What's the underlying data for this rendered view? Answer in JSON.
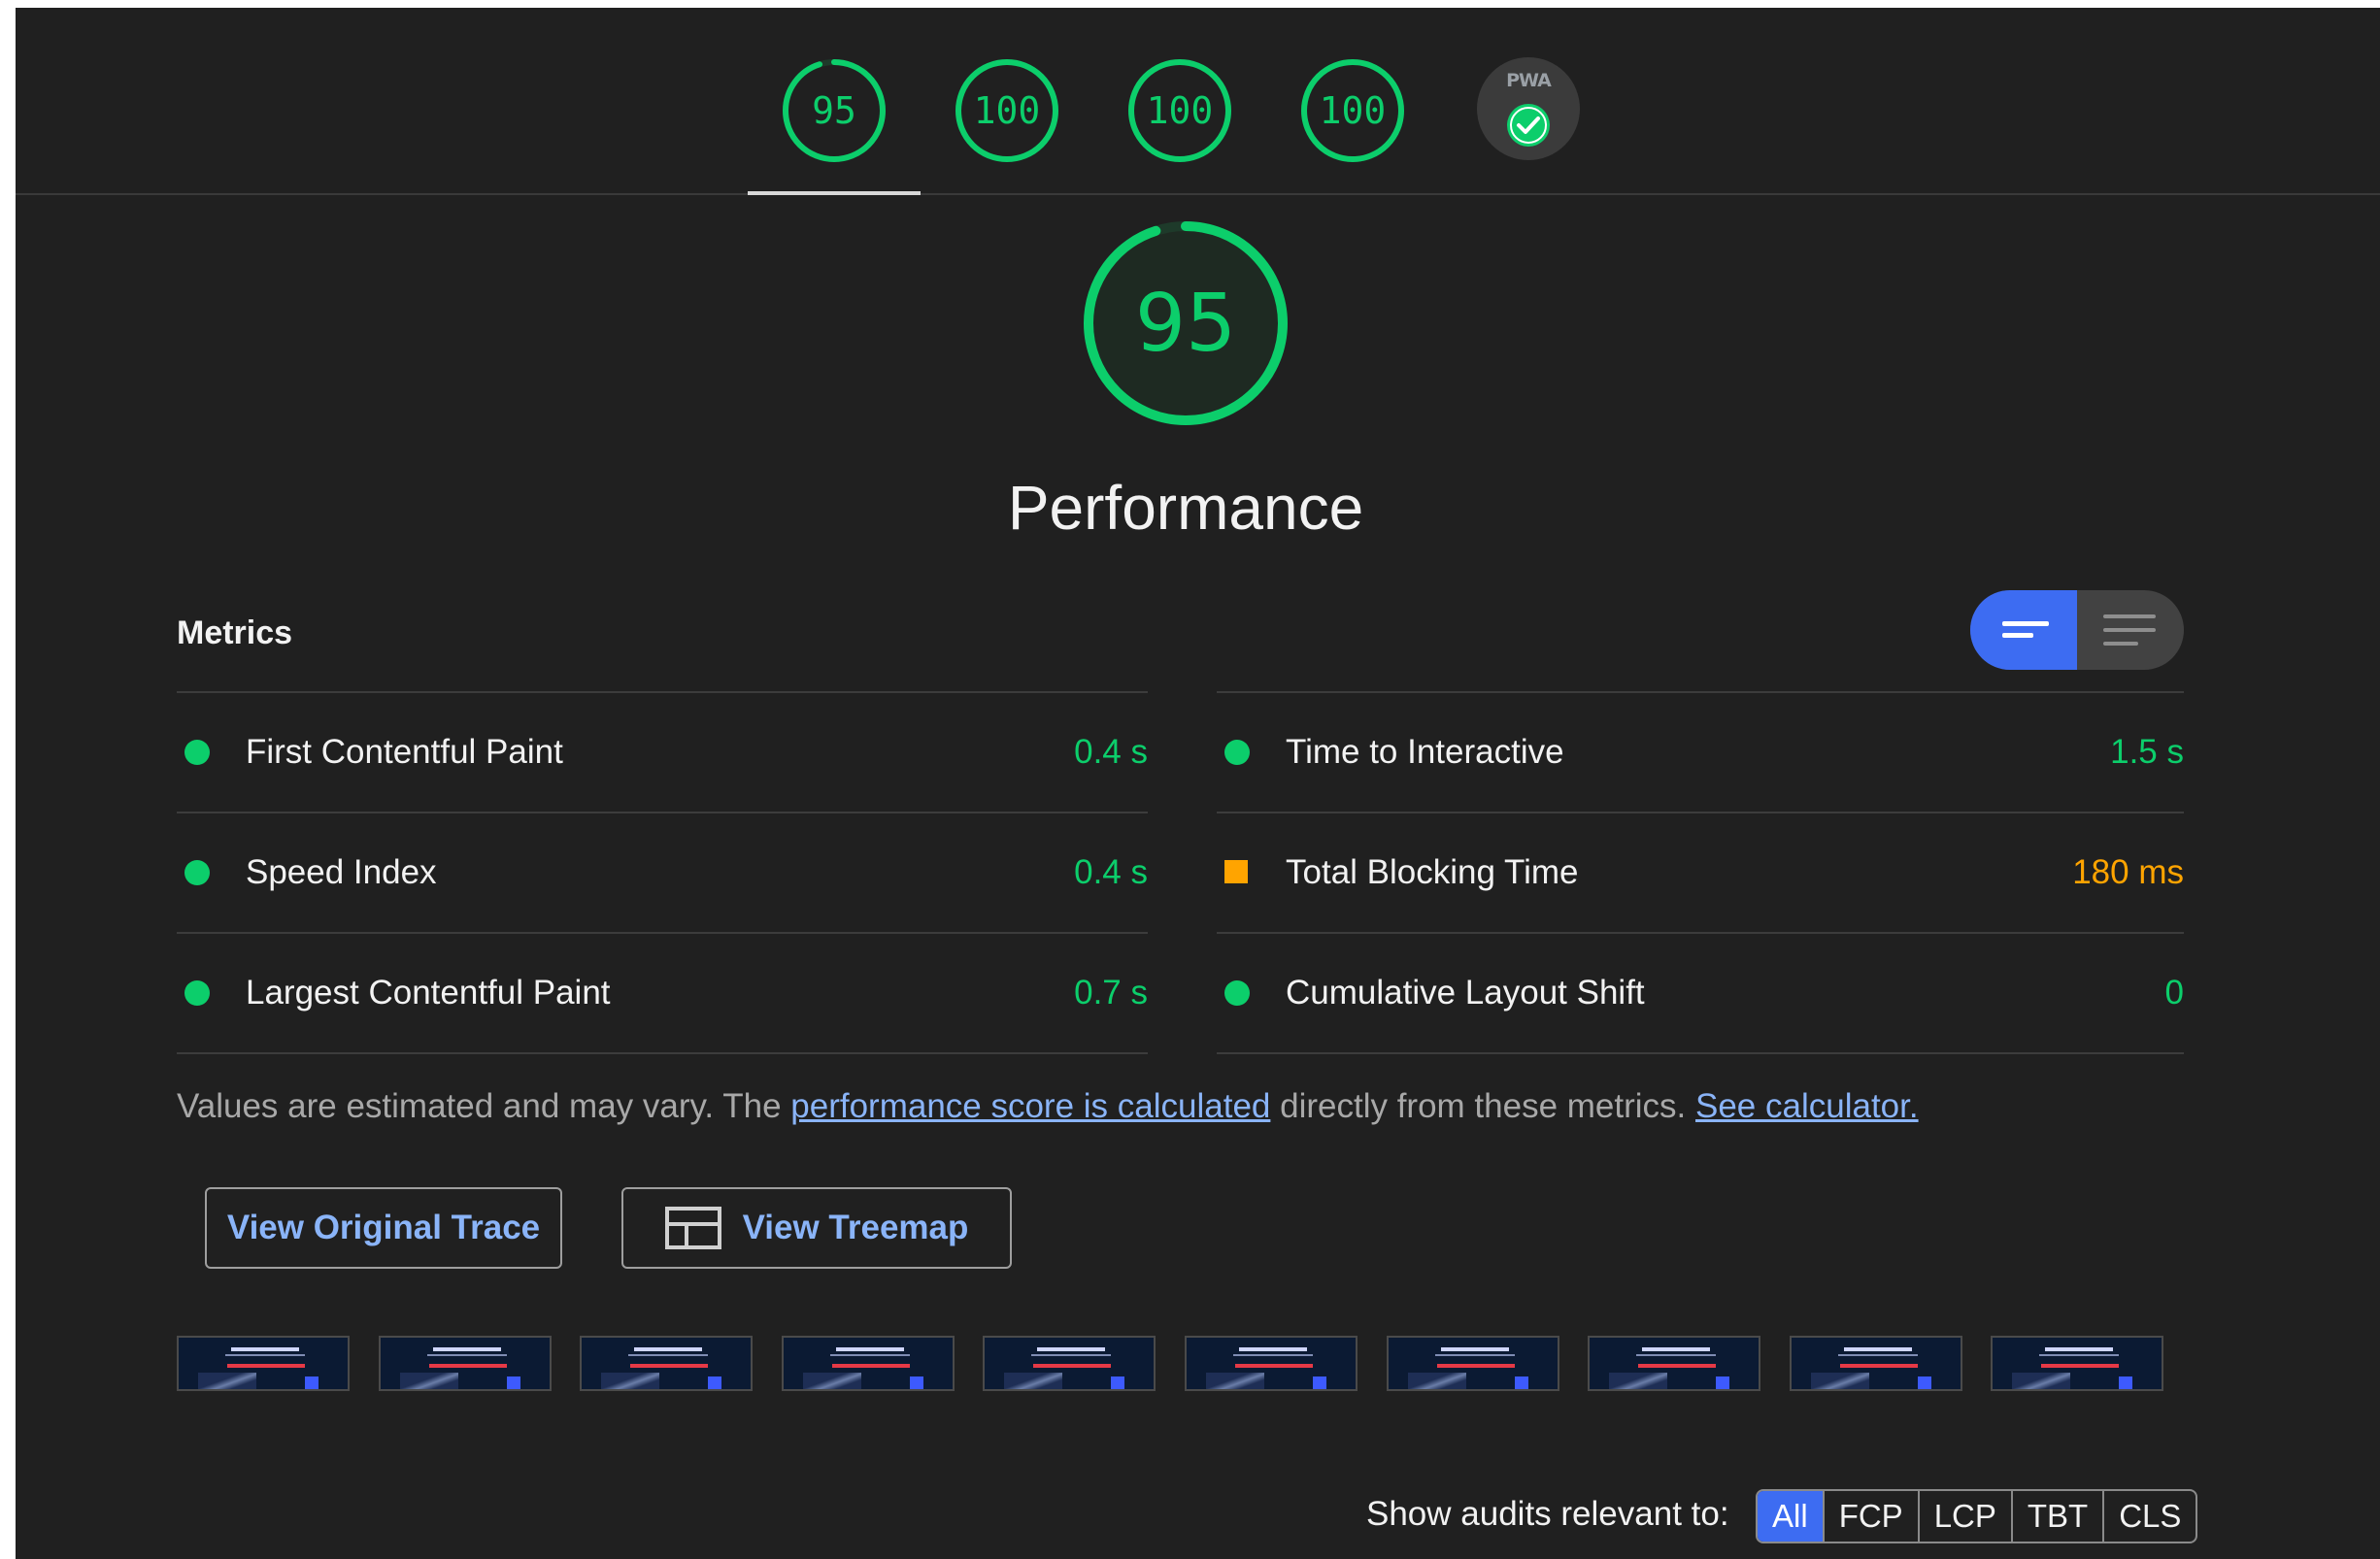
{
  "colors": {
    "pass": "#0cce6b",
    "average": "#ffa400",
    "accent": "#3d6cf2",
    "link": "#8ab4f8",
    "background": "#202020"
  },
  "gauges": [
    {
      "score": 95,
      "fraction": 0.95
    },
    {
      "score": 100,
      "fraction": 1.0
    },
    {
      "score": 100,
      "fraction": 1.0
    },
    {
      "score": 100,
      "fraction": 1.0
    }
  ],
  "pwa": {
    "label": "PWA",
    "icon": "check-circle-icon"
  },
  "performance": {
    "score": "95",
    "fraction": 0.95,
    "title": "Performance"
  },
  "metrics": {
    "title": "Metrics",
    "toggle": {
      "left_icon": "bars-summary-icon",
      "right_icon": "lines-detail-icon"
    },
    "left": [
      {
        "label": "First Contentful Paint",
        "value": "0.4 s",
        "status": "pass"
      },
      {
        "label": "Speed Index",
        "value": "0.4 s",
        "status": "pass"
      },
      {
        "label": "Largest Contentful Paint",
        "value": "0.7 s",
        "status": "pass"
      }
    ],
    "right": [
      {
        "label": "Time to Interactive",
        "value": "1.5 s",
        "status": "pass"
      },
      {
        "label": "Total Blocking Time",
        "value": "180 ms",
        "status": "average"
      },
      {
        "label": "Cumulative Layout Shift",
        "value": "0",
        "status": "pass"
      }
    ]
  },
  "note": {
    "pre": "Values are estimated and may vary. The ",
    "link1": "performance score is calculated",
    "mid": " directly from these metrics. ",
    "link2": "See calculator."
  },
  "buttons": {
    "trace": "View Original Trace",
    "treemap": "View Treemap",
    "treemap_icon": "treemap-icon"
  },
  "filmstrip_count": 10,
  "filters": {
    "label": "Show audits relevant to:",
    "chips": [
      "All",
      "FCP",
      "LCP",
      "TBT",
      "CLS"
    ],
    "active": "All"
  }
}
